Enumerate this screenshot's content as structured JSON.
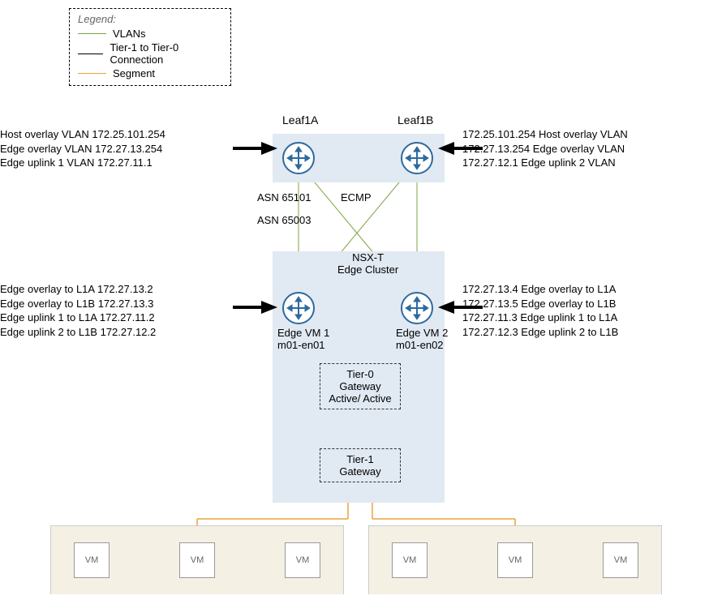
{
  "legend": {
    "title": "Legend:",
    "items": [
      {
        "label": "VLANs"
      },
      {
        "label": "Tier-1 to Tier-0 Connection"
      },
      {
        "label": "Segment"
      }
    ]
  },
  "leafs": {
    "leaf1a": "Leaf1A",
    "leaf1b": "Leaf1B"
  },
  "asn": {
    "asn1": "ASN 65101",
    "asn2": "ASN 65003",
    "ecmp": "ECMP"
  },
  "nsxt": {
    "line1": "NSX-T",
    "line2": "Edge Cluster"
  },
  "edges": {
    "edge1": {
      "name": "Edge VM 1",
      "id": "m01-en01"
    },
    "edge2": {
      "name": "Edge VM 2",
      "id": "m01-en02"
    }
  },
  "gateways": {
    "tier0": {
      "line1": "Tier-0",
      "line2": "Gateway",
      "line3": "Active/ Active"
    },
    "tier1": {
      "line1": "Tier-1",
      "line2": "Gateway"
    }
  },
  "callouts": {
    "leftTop": [
      "Host overlay VLAN 172.25.101.254",
      "Edge overlay VLAN 172.27.13.254",
      "Edge uplink 1 VLAN 172.27.11.1"
    ],
    "rightTop": [
      "172.25.101.254 Host overlay VLAN",
      "172.27.13.254 Edge overlay VLAN",
      "172.27.12.1 Edge uplink 2 VLAN"
    ],
    "leftMid": [
      "Edge overlay to L1A 172.27.13.2",
      "Edge overlay to L1B 172.27.13.3",
      "Edge uplink 1 to L1A 172.27.11.2",
      "Edge uplink 2 to L1B 172.27.12.2"
    ],
    "rightMid": [
      "172.27.13.4 Edge overlay to L1A",
      "172.27.13.5 Edge overlay to L1B",
      "172.27.11.3 Edge uplink 1 to L1A",
      "172.27.12.3 Edge uplink 2 to L1B"
    ]
  },
  "vm": {
    "label": "VM"
  }
}
